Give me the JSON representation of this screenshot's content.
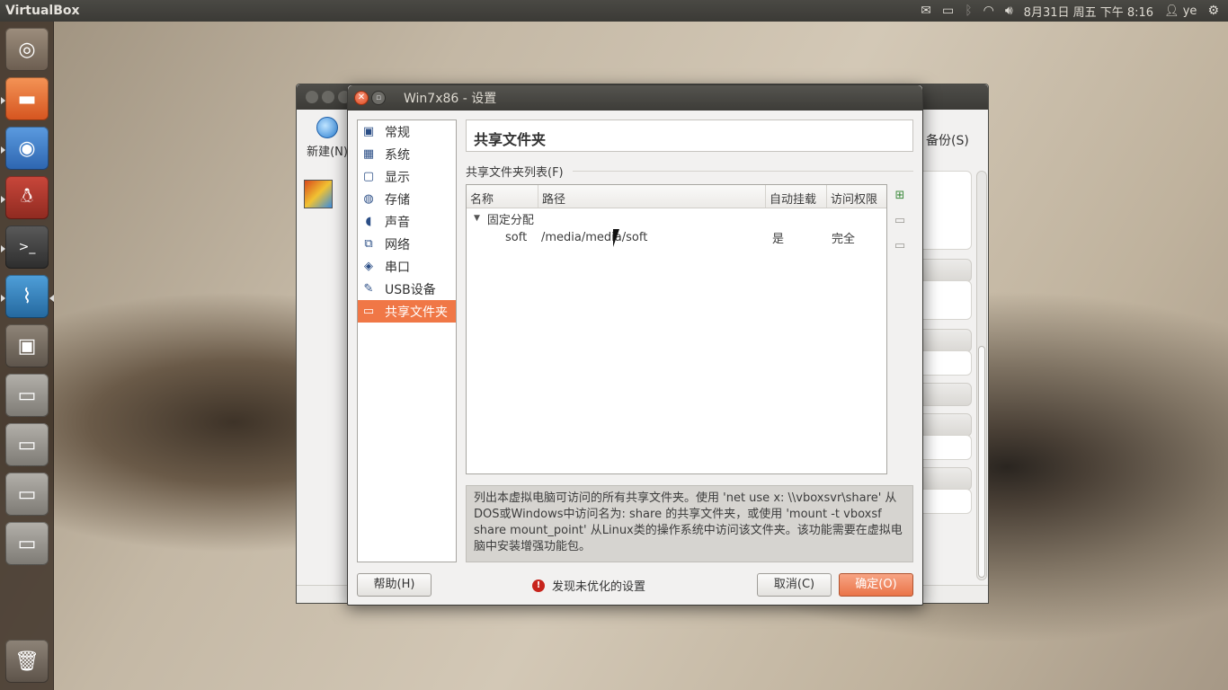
{
  "topbar": {
    "app_name": "VirtualBox",
    "datetime": "8月31日 周五 下午 8:16",
    "user": "ye",
    "icons": [
      "mail-icon",
      "battery-icon",
      "bluetooth-icon",
      "wifi-icon",
      "volume-icon",
      "user-icon",
      "gear-icon"
    ]
  },
  "launcher": {
    "items": [
      "dash-icon",
      "files-icon",
      "chromium-icon",
      "qq-icon",
      "terminal-icon",
      "system-monitor-icon",
      "workspace-switcher-icon",
      "drive-icon",
      "drive-icon",
      "drive-icon",
      "drive-icon",
      "trash-icon"
    ]
  },
  "mainwin": {
    "new_label": "新建(N)",
    "backup_label": "备份(S)"
  },
  "dialog": {
    "title": "Win7x86 - 设置",
    "nav": [
      {
        "label": "常规",
        "icon": "monitor-icon"
      },
      {
        "label": "系统",
        "icon": "chip-icon"
      },
      {
        "label": "显示",
        "icon": "display-icon"
      },
      {
        "label": "存储",
        "icon": "storage-icon"
      },
      {
        "label": "声音",
        "icon": "speaker-icon"
      },
      {
        "label": "网络",
        "icon": "network-icon"
      },
      {
        "label": "串口",
        "icon": "serial-icon"
      },
      {
        "label": "USB设备",
        "icon": "usb-icon"
      },
      {
        "label": "共享文件夹",
        "icon": "folder-icon",
        "selected": true
      }
    ],
    "section_title": "共享文件夹",
    "list_label": "共享文件夹列表(F)",
    "columns": {
      "name": "名称",
      "path": "路径",
      "auto_mount": "自动挂载",
      "access": "访问权限"
    },
    "group": "固定分配",
    "rows": [
      {
        "name": "soft",
        "path": "/media/media/soft",
        "auto_mount": "是",
        "access": "完全"
      }
    ],
    "info_text": "列出本虚拟电脑可访问的所有共享文件夹。使用 'net use x: \\\\vboxsvr\\share' 从DOS或Windows中访问名为: share 的共享文件夹，或使用 'mount -t vboxsf share mount_point' 从Linux类的操作系统中访问该文件夹。该功能需要在虚拟电脑中安装增强功能包。",
    "help": "帮助(H)",
    "warning": "发现未优化的设置",
    "cancel": "取消(C)",
    "ok": "确定(O)"
  }
}
